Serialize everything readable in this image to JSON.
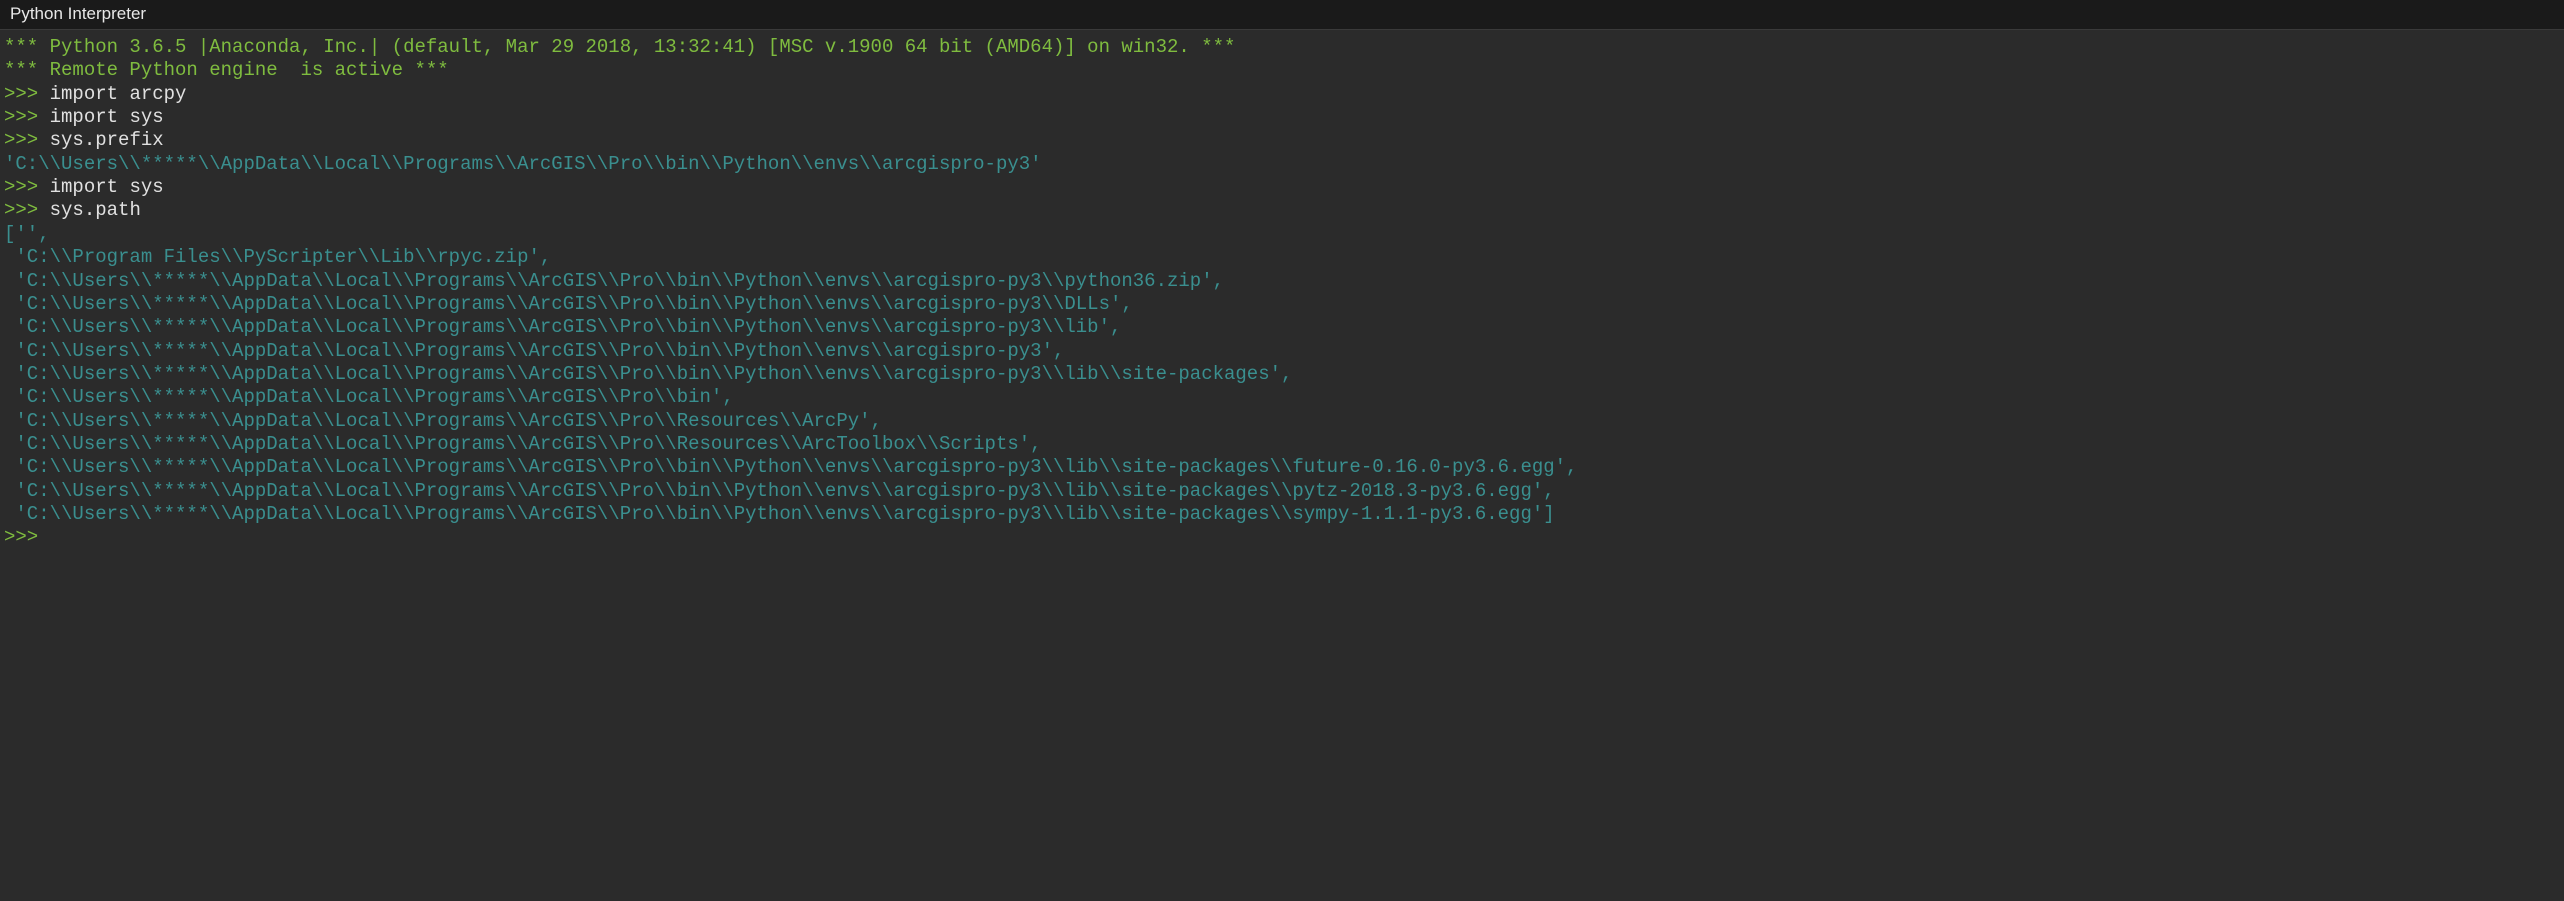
{
  "title": "Python Interpreter",
  "banner": {
    "line1": "*** Python 3.6.5 |Anaconda, Inc.| (default, Mar 29 2018, 13:32:41) [MSC v.1900 64 bit (AMD64)] on win32. ***",
    "line2": "*** Remote Python engine  is active ***"
  },
  "prompt": ">>>",
  "commands": {
    "cmd1": "import arcpy",
    "cmd2": "import sys",
    "cmd3": "sys.prefix",
    "cmd4": "import sys",
    "cmd5": "sys.path"
  },
  "outputs": {
    "prefix": "'C:\\\\Users\\\\*****\\\\AppData\\\\Local\\\\Programs\\\\ArcGIS\\\\Pro\\\\bin\\\\Python\\\\envs\\\\arcgispro-py3'",
    "pathOpen": "['',",
    "paths": [
      " 'C:\\\\Program Files\\\\PyScripter\\\\Lib\\\\rpyc.zip',",
      " 'C:\\\\Users\\\\*****\\\\AppData\\\\Local\\\\Programs\\\\ArcGIS\\\\Pro\\\\bin\\\\Python\\\\envs\\\\arcgispro-py3\\\\python36.zip',",
      " 'C:\\\\Users\\\\*****\\\\AppData\\\\Local\\\\Programs\\\\ArcGIS\\\\Pro\\\\bin\\\\Python\\\\envs\\\\arcgispro-py3\\\\DLLs',",
      " 'C:\\\\Users\\\\*****\\\\AppData\\\\Local\\\\Programs\\\\ArcGIS\\\\Pro\\\\bin\\\\Python\\\\envs\\\\arcgispro-py3\\\\lib',",
      " 'C:\\\\Users\\\\*****\\\\AppData\\\\Local\\\\Programs\\\\ArcGIS\\\\Pro\\\\bin\\\\Python\\\\envs\\\\arcgispro-py3',",
      " 'C:\\\\Users\\\\*****\\\\AppData\\\\Local\\\\Programs\\\\ArcGIS\\\\Pro\\\\bin\\\\Python\\\\envs\\\\arcgispro-py3\\\\lib\\\\site-packages',",
      " 'C:\\\\Users\\\\*****\\\\AppData\\\\Local\\\\Programs\\\\ArcGIS\\\\Pro\\\\bin',",
      " 'C:\\\\Users\\\\*****\\\\AppData\\\\Local\\\\Programs\\\\ArcGIS\\\\Pro\\\\Resources\\\\ArcPy',",
      " 'C:\\\\Users\\\\*****\\\\AppData\\\\Local\\\\Programs\\\\ArcGIS\\\\Pro\\\\Resources\\\\ArcToolbox\\\\Scripts',",
      " 'C:\\\\Users\\\\*****\\\\AppData\\\\Local\\\\Programs\\\\ArcGIS\\\\Pro\\\\bin\\\\Python\\\\envs\\\\arcgispro-py3\\\\lib\\\\site-packages\\\\future-0.16.0-py3.6.egg',",
      " 'C:\\\\Users\\\\*****\\\\AppData\\\\Local\\\\Programs\\\\ArcGIS\\\\Pro\\\\bin\\\\Python\\\\envs\\\\arcgispro-py3\\\\lib\\\\site-packages\\\\pytz-2018.3-py3.6.egg',",
      " 'C:\\\\Users\\\\*****\\\\AppData\\\\Local\\\\Programs\\\\ArcGIS\\\\Pro\\\\bin\\\\Python\\\\envs\\\\arcgispro-py3\\\\lib\\\\site-packages\\\\sympy-1.1.1-py3.6.egg']"
    ]
  }
}
